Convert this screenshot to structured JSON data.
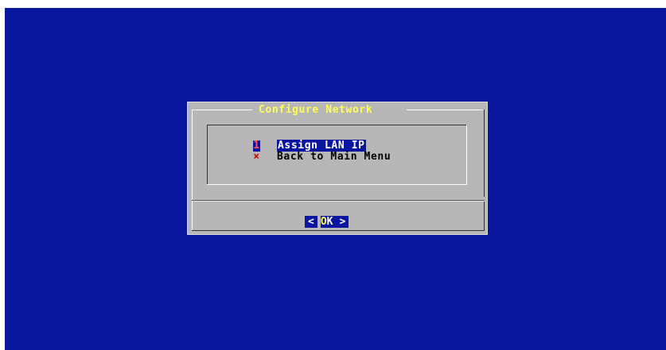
{
  "dialog": {
    "title": "Configure Network",
    "menu_items": [
      {
        "key": "1",
        "label": "Assign LAN IP",
        "selected": true
      },
      {
        "key": "×",
        "label": "Back to Main Menu",
        "selected": false
      }
    ],
    "ok_button": {
      "left": "<",
      "hotkey": "O",
      "rest": "K",
      "right": ">"
    }
  },
  "colors": {
    "screen_background": "#0a169e",
    "dialog_background": "#b7b7b7",
    "title_color": "#ffff55",
    "highlight": "#0a169e"
  }
}
